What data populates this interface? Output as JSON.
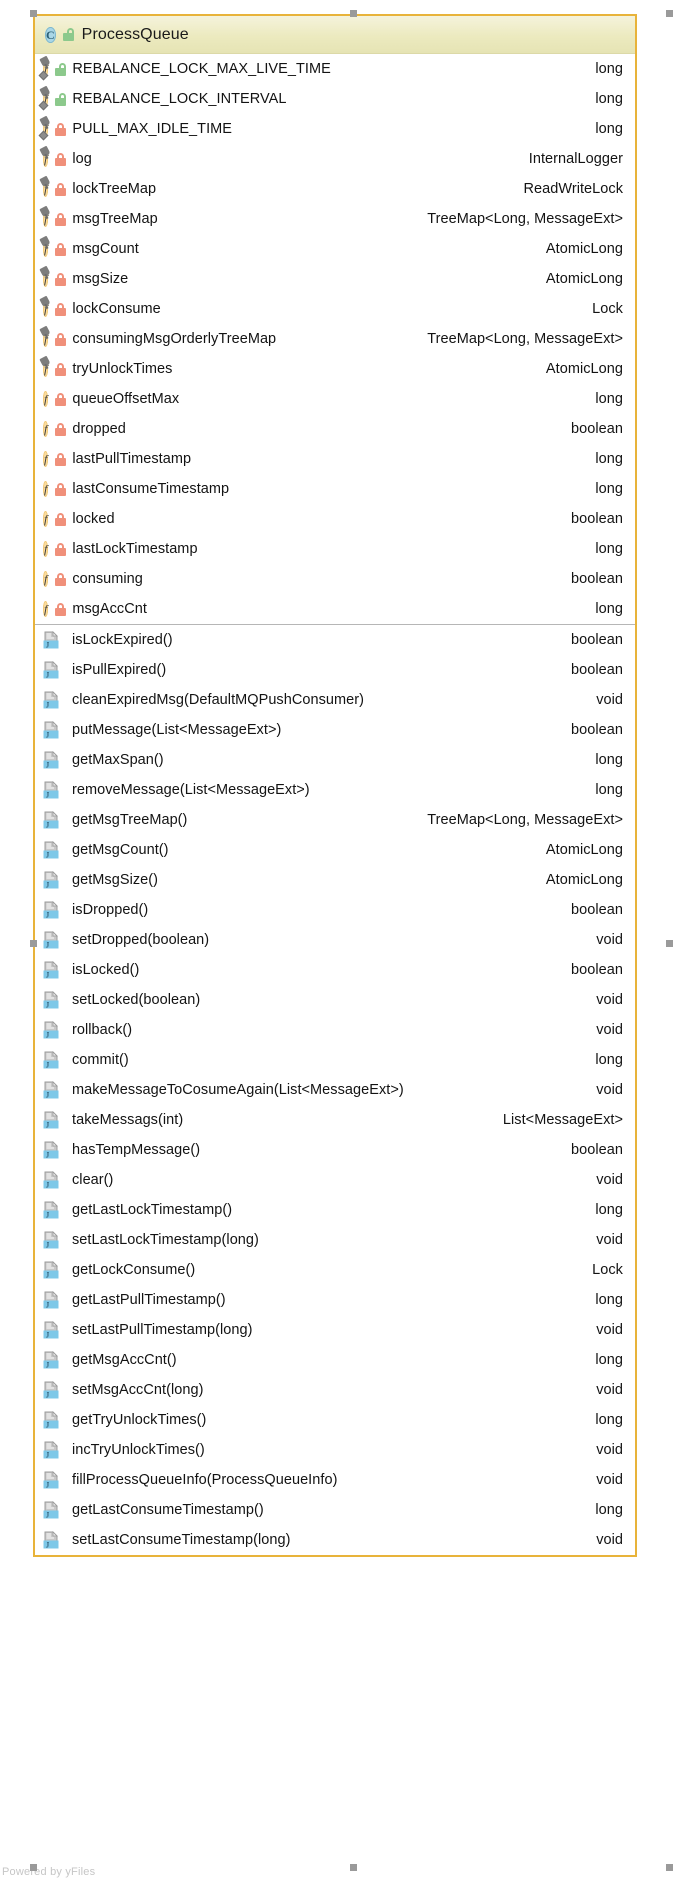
{
  "diagram": {
    "kind": "uml-class-diagram",
    "watermark": "Powered by yFiles",
    "accent_border_color": "#e8b33a",
    "header_gradient_from": "#f5f3dc",
    "header_gradient_to": "#e6e4b4",
    "class_icon_color": "#a9d6e6",
    "field_icon_color": "#fbdda0",
    "method_icon_color": "#7ec8e8",
    "lock_public_color": "#8cc98c",
    "lock_private_color": "#f0907a"
  },
  "class_node": {
    "icon": "class-icon",
    "visibility": "public",
    "visibility_icon": "unlocked-padlock-icon",
    "name": "ProcessQueue"
  },
  "fields": [
    {
      "icon": "field-static-final-icon",
      "visibility": "public",
      "name": "REBALANCE_LOCK_MAX_LIVE_TIME",
      "type": "long"
    },
    {
      "icon": "field-static-final-icon",
      "visibility": "public",
      "name": "REBALANCE_LOCK_INTERVAL",
      "type": "long"
    },
    {
      "icon": "field-static-final-icon",
      "visibility": "private",
      "name": "PULL_MAX_IDLE_TIME",
      "type": "long"
    },
    {
      "icon": "field-static-icon",
      "visibility": "private",
      "name": "log",
      "type": "InternalLogger"
    },
    {
      "icon": "field-static-icon",
      "visibility": "private",
      "name": "lockTreeMap",
      "type": "ReadWriteLock"
    },
    {
      "icon": "field-static-icon",
      "visibility": "private",
      "name": "msgTreeMap",
      "type": "TreeMap<Long, MessageExt>"
    },
    {
      "icon": "field-static-icon",
      "visibility": "private",
      "name": "msgCount",
      "type": "AtomicLong"
    },
    {
      "icon": "field-static-icon",
      "visibility": "private",
      "name": "msgSize",
      "type": "AtomicLong"
    },
    {
      "icon": "field-static-icon",
      "visibility": "private",
      "name": "lockConsume",
      "type": "Lock"
    },
    {
      "icon": "field-static-icon",
      "visibility": "private",
      "name": "consumingMsgOrderlyTreeMap",
      "type": "TreeMap<Long, MessageExt>"
    },
    {
      "icon": "field-static-icon",
      "visibility": "private",
      "name": "tryUnlockTimes",
      "type": "AtomicLong"
    },
    {
      "icon": "field-icon",
      "visibility": "private",
      "name": "queueOffsetMax",
      "type": "long"
    },
    {
      "icon": "field-icon",
      "visibility": "private",
      "name": "dropped",
      "type": "boolean"
    },
    {
      "icon": "field-icon",
      "visibility": "private",
      "name": "lastPullTimestamp",
      "type": "long"
    },
    {
      "icon": "field-icon",
      "visibility": "private",
      "name": "lastConsumeTimestamp",
      "type": "long"
    },
    {
      "icon": "field-icon",
      "visibility": "private",
      "name": "locked",
      "type": "boolean"
    },
    {
      "icon": "field-icon",
      "visibility": "private",
      "name": "lastLockTimestamp",
      "type": "long"
    },
    {
      "icon": "field-icon",
      "visibility": "private",
      "name": "consuming",
      "type": "boolean"
    },
    {
      "icon": "field-icon",
      "visibility": "private",
      "name": "msgAccCnt",
      "type": "long"
    }
  ],
  "methods": [
    {
      "icon": "method-icon",
      "name": "isLockExpired()",
      "type": "boolean"
    },
    {
      "icon": "method-icon",
      "name": "isPullExpired()",
      "type": "boolean"
    },
    {
      "icon": "method-icon",
      "name": "cleanExpiredMsg(DefaultMQPushConsumer)",
      "type": "void"
    },
    {
      "icon": "method-icon",
      "name": "putMessage(List<MessageExt>)",
      "type": "boolean"
    },
    {
      "icon": "method-icon",
      "name": "getMaxSpan()",
      "type": "long"
    },
    {
      "icon": "method-icon",
      "name": "removeMessage(List<MessageExt>)",
      "type": "long"
    },
    {
      "icon": "method-icon",
      "name": "getMsgTreeMap()",
      "type": "TreeMap<Long, MessageExt>"
    },
    {
      "icon": "method-icon",
      "name": "getMsgCount()",
      "type": "AtomicLong"
    },
    {
      "icon": "method-icon",
      "name": "getMsgSize()",
      "type": "AtomicLong"
    },
    {
      "icon": "method-icon",
      "name": "isDropped()",
      "type": "boolean"
    },
    {
      "icon": "method-icon",
      "name": "setDropped(boolean)",
      "type": "void"
    },
    {
      "icon": "method-icon",
      "name": "isLocked()",
      "type": "boolean"
    },
    {
      "icon": "method-icon",
      "name": "setLocked(boolean)",
      "type": "void"
    },
    {
      "icon": "method-icon",
      "name": "rollback()",
      "type": "void"
    },
    {
      "icon": "method-icon",
      "name": "commit()",
      "type": "long"
    },
    {
      "icon": "method-icon",
      "name": "makeMessageToCosumeAgain(List<MessageExt>)",
      "type": "void"
    },
    {
      "icon": "method-icon",
      "name": "takeMessags(int)",
      "type": "List<MessageExt>"
    },
    {
      "icon": "method-icon",
      "name": "hasTempMessage()",
      "type": "boolean"
    },
    {
      "icon": "method-icon",
      "name": "clear()",
      "type": "void"
    },
    {
      "icon": "method-icon",
      "name": "getLastLockTimestamp()",
      "type": "long"
    },
    {
      "icon": "method-icon",
      "name": "setLastLockTimestamp(long)",
      "type": "void"
    },
    {
      "icon": "method-icon",
      "name": "getLockConsume()",
      "type": "Lock"
    },
    {
      "icon": "method-icon",
      "name": "getLastPullTimestamp()",
      "type": "long"
    },
    {
      "icon": "method-icon",
      "name": "setLastPullTimestamp(long)",
      "type": "void"
    },
    {
      "icon": "method-icon",
      "name": "getMsgAccCnt()",
      "type": "long"
    },
    {
      "icon": "method-icon",
      "name": "setMsgAccCnt(long)",
      "type": "void"
    },
    {
      "icon": "method-icon",
      "name": "getTryUnlockTimes()",
      "type": "long"
    },
    {
      "icon": "method-icon",
      "name": "incTryUnlockTimes()",
      "type": "void"
    },
    {
      "icon": "method-icon",
      "name": "fillProcessQueueInfo(ProcessQueueInfo)",
      "type": "void"
    },
    {
      "icon": "method-icon",
      "name": "getLastConsumeTimestamp()",
      "type": "long"
    },
    {
      "icon": "method-icon",
      "name": "setLastConsumeTimestamp(long)",
      "type": "void"
    }
  ]
}
